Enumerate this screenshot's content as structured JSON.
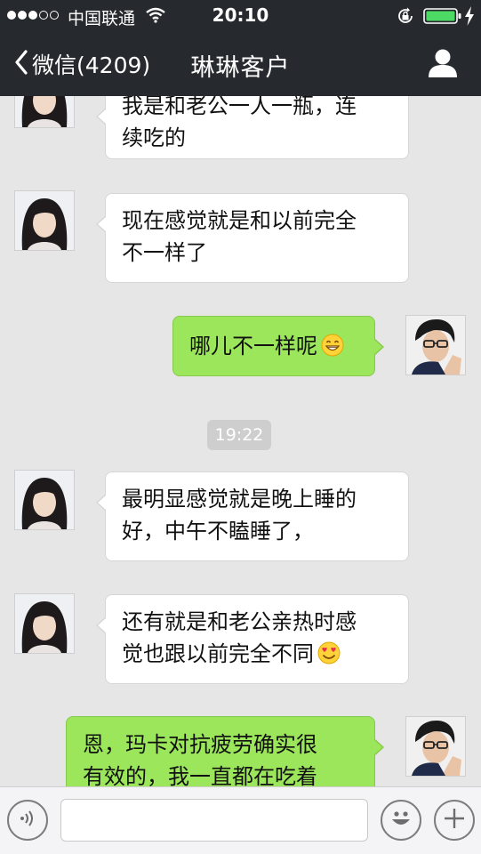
{
  "status_bar": {
    "carrier": "中国联通",
    "time": "20:10"
  },
  "nav": {
    "back_label": "微信(4209)",
    "title": "琳琳客户",
    "back_icon": "chevron-left-icon",
    "contact_icon": "person-icon"
  },
  "chat": {
    "messages": [
      {
        "side": "left",
        "lines": [
          "我是和老公一人一瓶，连",
          "续吃的"
        ]
      },
      {
        "side": "left",
        "lines": [
          "现在感觉就是和以前完全",
          "不一样了"
        ]
      },
      {
        "side": "right",
        "lines": [
          "哪儿不一样呢"
        ],
        "emoji": "grinning-face"
      },
      {
        "side": "left",
        "lines": [
          "最明显感觉就是晚上睡的",
          "好，中午不瞌睡了，"
        ]
      },
      {
        "side": "left",
        "lines": [
          "还有就是和老公亲热时感",
          "觉也跟以前完全不同"
        ],
        "emoji": "heart-eyes-face"
      },
      {
        "side": "right",
        "lines": [
          "恩，玛卡对抗疲劳确实很",
          "有效的，我一直都在吃着"
        ]
      }
    ],
    "timestamp": "19:22"
  },
  "input_bar": {
    "message_value": "",
    "voice_icon": "voice-icon",
    "emoji_icon": "smiley-icon",
    "plus_icon": "plus-icon"
  },
  "colors": {
    "header_bg": "#262a2e",
    "chat_bg": "#e6e6e6",
    "own_bubble": "#9be65a",
    "other_bubble": "#ffffff",
    "time_badge": "#cecece"
  }
}
